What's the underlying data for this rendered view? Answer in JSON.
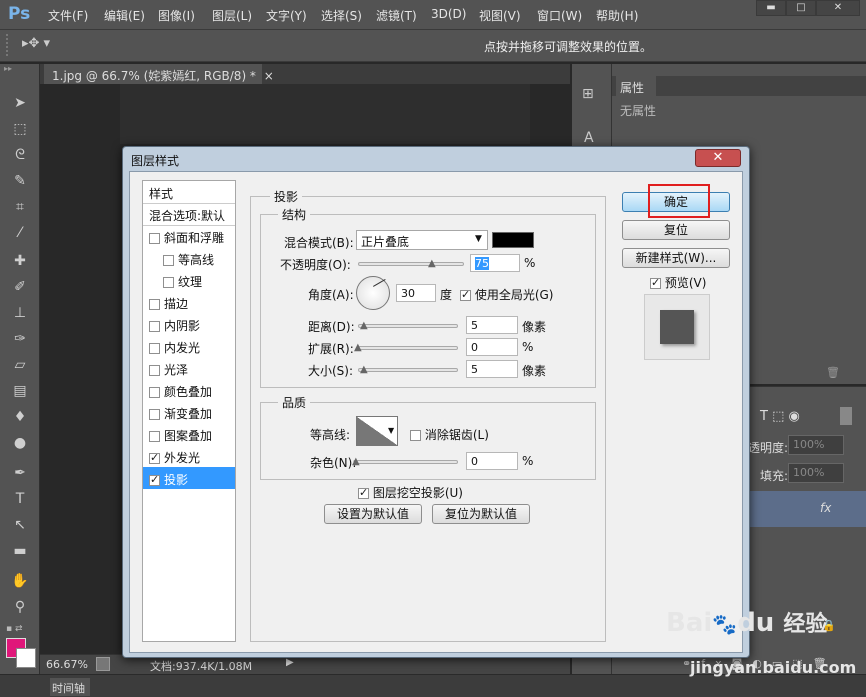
{
  "app": {
    "logo": "Ps"
  },
  "menu": [
    "文件(F)",
    "编辑(E)",
    "图像(I)",
    "图层(L)",
    "文字(Y)",
    "选择(S)",
    "滤镜(T)",
    "3D(D)",
    "视图(V)",
    "窗口(W)",
    "帮助(H)"
  ],
  "window_controls": {
    "minimize": "▬",
    "maximize": "□",
    "close": "✕"
  },
  "options_bar": {
    "hint": "点按并拖移可调整效果的位置。"
  },
  "document_tab": {
    "label": "1.jpg @ 66.7% (姹紫嫣红, RGB/8) *",
    "close": "×"
  },
  "status_bar": {
    "zoom": "66.67%",
    "doc_info": "文档:937.4K/1.08M"
  },
  "timeline": {
    "label": "时间轴"
  },
  "properties_panel": {
    "tab": "属性",
    "empty_text": "无属性"
  },
  "layers_panel": {
    "opacity_label": "透明度:",
    "opacity_value": "100%",
    "fill_label": "填充:",
    "fill_value": "100%",
    "fx": "fx"
  },
  "dialog": {
    "title": "图层样式",
    "close": "✕",
    "styles_header": "样式",
    "blend_options": "混合选项:默认",
    "style_items": [
      {
        "label": "斜面和浮雕",
        "checked": false,
        "indent": false
      },
      {
        "label": "等高线",
        "checked": false,
        "indent": true
      },
      {
        "label": "纹理",
        "checked": false,
        "indent": true
      },
      {
        "label": "描边",
        "checked": false,
        "indent": false
      },
      {
        "label": "内阴影",
        "checked": false,
        "indent": false
      },
      {
        "label": "内发光",
        "checked": false,
        "indent": false
      },
      {
        "label": "光泽",
        "checked": false,
        "indent": false
      },
      {
        "label": "颜色叠加",
        "checked": false,
        "indent": false
      },
      {
        "label": "渐变叠加",
        "checked": false,
        "indent": false
      },
      {
        "label": "图案叠加",
        "checked": false,
        "indent": false
      },
      {
        "label": "外发光",
        "checked": true,
        "indent": false
      },
      {
        "label": "投影",
        "checked": true,
        "indent": false,
        "selected": true
      }
    ],
    "section_title": "投影",
    "structure": {
      "legend": "结构",
      "blend_mode_label": "混合模式(B):",
      "blend_mode_value": "正片叠底",
      "shadow_color": "#000000",
      "opacity_label": "不透明度(O):",
      "opacity_value": "75",
      "opacity_unit": "%",
      "angle_label": "角度(A):",
      "angle_value": "30",
      "angle_unit": "度",
      "global_light_label": "使用全局光(G)",
      "global_light_checked": true,
      "distance_label": "距离(D):",
      "distance_value": "5",
      "distance_unit": "像素",
      "spread_label": "扩展(R):",
      "spread_value": "0",
      "spread_unit": "%",
      "size_label": "大小(S):",
      "size_value": "5",
      "size_unit": "像素"
    },
    "quality": {
      "legend": "品质",
      "contour_label": "等高线:",
      "antialias_label": "消除锯齿(L)",
      "antialias_checked": false,
      "noise_label": "杂色(N):",
      "noise_value": "0",
      "noise_unit": "%"
    },
    "knockout_label": "图层挖空投影(U)",
    "knockout_checked": true,
    "make_default": "设置为默认值",
    "reset_default": "复位为默认值",
    "ok": "确定",
    "reset": "复位",
    "new_style": "新建样式(W)...",
    "preview_label": "预览(V)",
    "preview_checked": true
  },
  "watermark": {
    "brand": "Bai",
    "brand2": "du",
    "product": "经验",
    "url": "jingyan.baidu.com"
  }
}
